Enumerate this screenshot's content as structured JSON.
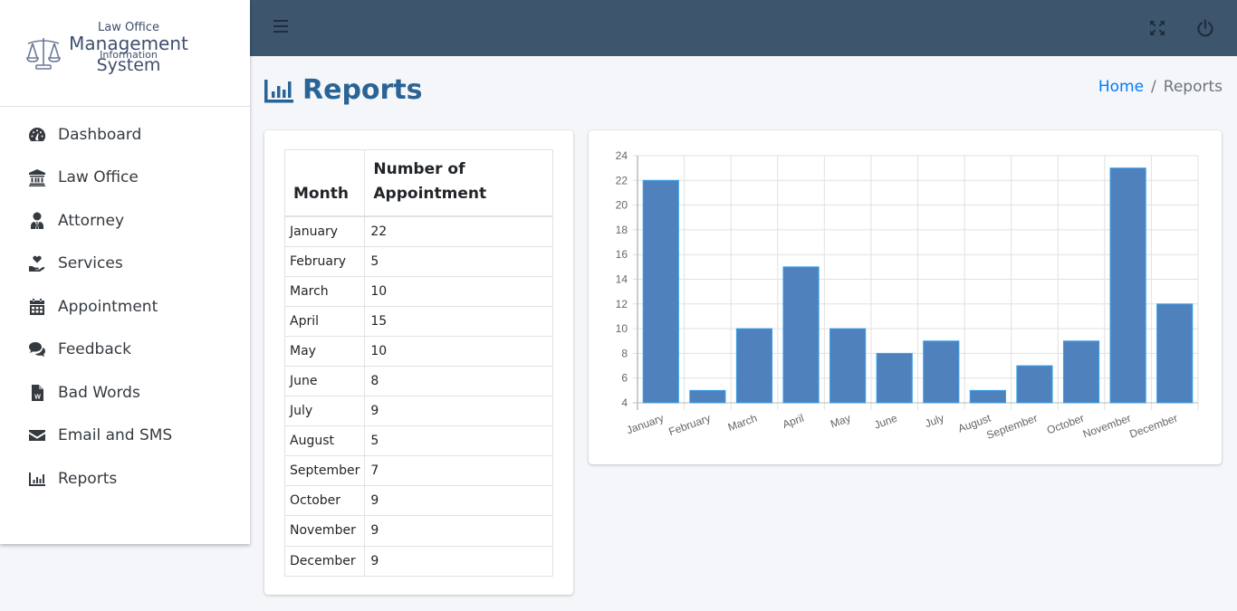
{
  "brand": {
    "line1": "Law Office",
    "line2": "Management",
    "line3": "Information",
    "line4": "System",
    "icon": "scales-of-justice-icon"
  },
  "sidebar": {
    "items": [
      {
        "label": "Dashboard",
        "icon": "tachometer-icon"
      },
      {
        "label": "Law Office",
        "icon": "university-icon"
      },
      {
        "label": "Attorney",
        "icon": "user-tie-icon"
      },
      {
        "label": "Services",
        "icon": "hand-holding-heart-icon"
      },
      {
        "label": "Appointment",
        "icon": "calendar-icon"
      },
      {
        "label": "Feedback",
        "icon": "comments-icon"
      },
      {
        "label": "Bad Words",
        "icon": "file-word-icon"
      },
      {
        "label": "Email and SMS",
        "icon": "envelope-icon"
      },
      {
        "label": "Reports",
        "icon": "chart-bar-icon"
      }
    ]
  },
  "topbar": {
    "menu_icon": "bars-icon",
    "fullscreen_icon": "expand-arrows-icon",
    "logout_icon": "power-off-icon"
  },
  "header": {
    "title": "Reports",
    "title_icon": "chart-bar-icon",
    "breadcrumb": {
      "home": "Home",
      "separator": "/",
      "current": "Reports"
    }
  },
  "table": {
    "headers": [
      "Month",
      "Number of Appointment"
    ],
    "rows": [
      [
        "January",
        "22"
      ],
      [
        "February",
        "5"
      ],
      [
        "March",
        "10"
      ],
      [
        "April",
        "15"
      ],
      [
        "May",
        "10"
      ],
      [
        "June",
        "8"
      ],
      [
        "July",
        "9"
      ],
      [
        "August",
        "5"
      ],
      [
        "September",
        "7"
      ],
      [
        "October",
        "9"
      ],
      [
        "November",
        "9"
      ],
      [
        "December",
        "9"
      ]
    ]
  },
  "colors": {
    "topbar": "#3d566e",
    "accent": "#2a6496",
    "link": "#007bff",
    "bar_fill": "#4f81bd",
    "bar_border": "#36a2eb"
  },
  "chart_data": {
    "type": "bar",
    "title": "",
    "xlabel": "",
    "ylabel": "",
    "categories": [
      "January",
      "February",
      "March",
      "April",
      "May",
      "June",
      "July",
      "August",
      "September",
      "October",
      "November",
      "December"
    ],
    "values": [
      22,
      5,
      10,
      15,
      10,
      8,
      9,
      5,
      7,
      9,
      23,
      12
    ],
    "ylim": [
      4,
      24
    ],
    "yticks": [
      4,
      6,
      8,
      10,
      12,
      14,
      16,
      18,
      20,
      22,
      24
    ],
    "grid": true,
    "legend": "none"
  }
}
